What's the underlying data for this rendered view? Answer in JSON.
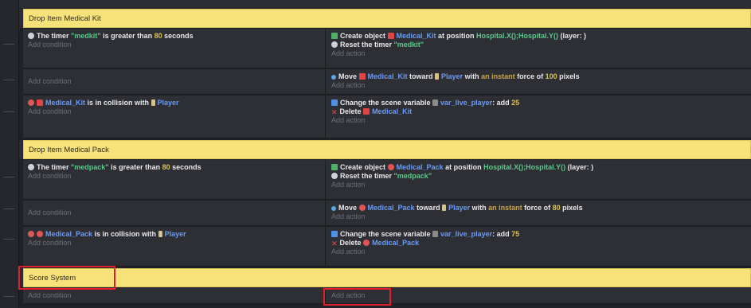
{
  "groups": {
    "kit": "Drop Item Medical Kit",
    "pack": "Drop Item Medical Pack",
    "score": "Score System"
  },
  "placeholders": {
    "add_condition": "Add condition",
    "add_action": "Add action"
  },
  "kit": {
    "e1": {
      "cond_pre": "The timer ",
      "cond_timer": "\"medkit\"",
      "cond_mid": " is greater than ",
      "cond_num": "80",
      "cond_post": " seconds",
      "a1_pre": "Create object ",
      "a1_obj": "Medical_Kit",
      "a1_mid": " at position ",
      "a1_pos": "Hospital.X();Hospital.Y()",
      "a1_post": " (layer: )",
      "a2_pre": "Reset the timer ",
      "a2_timer": "\"medkit\""
    },
    "e2": {
      "a1_pre": "Move ",
      "a1_obj": "Medical_Kit",
      "a1_mid": " toward ",
      "a1_target": "Player",
      "a1_with": " with ",
      "a1_instant": "an instant",
      "a1_force": " force of ",
      "a1_num": "100",
      "a1_post": " pixels"
    },
    "e3": {
      "c_obj": "Medical_Kit",
      "c_mid": " is in collision with ",
      "c_target": "Player",
      "a1_pre": "Change the scene variable ",
      "a1_var": "var_live_player",
      "a1_add": ": add ",
      "a1_num": "25",
      "a2_pre": "Delete ",
      "a2_obj": "Medical_Kit"
    }
  },
  "pack": {
    "e1": {
      "cond_pre": "The timer ",
      "cond_timer": "\"medpack\"",
      "cond_mid": " is greater than ",
      "cond_num": "80",
      "cond_post": " seconds",
      "a1_pre": "Create object ",
      "a1_obj": "Medical_Pack",
      "a1_mid": " at position ",
      "a1_pos": "Hospital.X();Hospital.Y()",
      "a1_post": " (layer: )",
      "a2_pre": "Reset the timer ",
      "a2_timer": "\"medpack\""
    },
    "e2": {
      "a1_pre": "Move ",
      "a1_obj": "Medical_Pack",
      "a1_mid": " toward ",
      "a1_target": "Player",
      "a1_with": " with ",
      "a1_instant": "an instant",
      "a1_force": " force of ",
      "a1_num": "80",
      "a1_post": " pixels"
    },
    "e3": {
      "c_obj": "Medical_Pack",
      "c_mid": " is in collision with ",
      "c_target": "Player",
      "a1_pre": "Change the scene variable ",
      "a1_var": "var_live_player",
      "a1_add": ": add ",
      "a1_num": "75",
      "a2_pre": "Delete ",
      "a2_obj": "Medical_Pack"
    }
  },
  "colors": {
    "group_header": "#f7e27a",
    "event_bg": "#2d2f35",
    "highlight": "#e0202a",
    "object_link": "#6b9bf2",
    "string_literal": "#5dc78a",
    "number_literal": "#e0c24f"
  },
  "icons": [
    "timer-icon",
    "create-object-icon",
    "medical-kit-icon",
    "medical-pack-icon",
    "player-icon",
    "move-icon",
    "collision-icon",
    "scene-variable-icon",
    "variable-icon",
    "delete-icon"
  ]
}
